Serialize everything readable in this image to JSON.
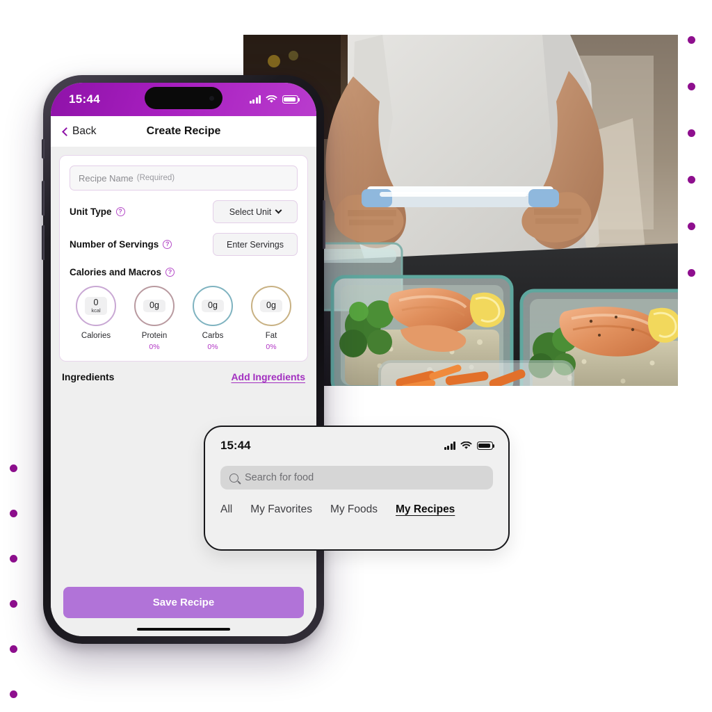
{
  "phone": {
    "status_bar": {
      "time": "15:44",
      "signal_icon": "cellular-signal-icon",
      "wifi_icon": "wifi-icon",
      "battery_icon": "battery-icon"
    },
    "nav": {
      "back_label": "Back",
      "title": "Create Recipe",
      "back_icon": "chevron-left-icon"
    },
    "form": {
      "recipe_name_placeholder": "Recipe Name",
      "recipe_name_required": "(Required)",
      "recipe_name_value": "",
      "unit_type_label": "Unit Type",
      "unit_type_button": "Select Unit",
      "servings_label": "Number of Servings",
      "servings_button": "Enter Servings",
      "macros_label": "Calories and Macros",
      "help_icon": "help-circle-icon",
      "macros": [
        {
          "name": "Calories",
          "value": "0",
          "unit": "kcal",
          "percent": "",
          "ring_color": "#c9a8d4"
        },
        {
          "name": "Protein",
          "value": "0g",
          "unit": "",
          "percent": "0%",
          "ring_color": "#b99aa0"
        },
        {
          "name": "Carbs",
          "value": "0g",
          "unit": "",
          "percent": "0%",
          "ring_color": "#7fb3c0"
        },
        {
          "name": "Fat",
          "value": "0g",
          "unit": "",
          "percent": "0%",
          "ring_color": "#c8b183"
        }
      ]
    },
    "ingredients": {
      "title": "Ingredients",
      "add_link": "Add Ingredients",
      "items": []
    },
    "save_button": "Save Recipe"
  },
  "search_card": {
    "status_bar": {
      "time": "15:44",
      "signal_icon": "cellular-signal-icon",
      "wifi_icon": "wifi-icon",
      "battery_icon": "battery-icon"
    },
    "search": {
      "placeholder": "Search for food",
      "value": "",
      "icon": "search-icon"
    },
    "tabs": [
      {
        "label": "All",
        "active": false
      },
      {
        "label": "My Favorites",
        "active": false
      },
      {
        "label": "My Foods",
        "active": false
      },
      {
        "label": "My Recipes",
        "active": true
      }
    ]
  },
  "decor": {
    "dot_color": "#8e0f8e",
    "right_dots": 6,
    "left_dots": 6
  },
  "hero_photo": {
    "alt": "Person in grey t-shirt holding a meal prep container lid over glass containers of salmon, broccoli, rice and sweet potato fries"
  },
  "theme": {
    "accent_purple": "#a81fc0",
    "button_purple": "#b173d8",
    "link_purple": "#a22fc0",
    "screen_bg": "#efefef"
  }
}
